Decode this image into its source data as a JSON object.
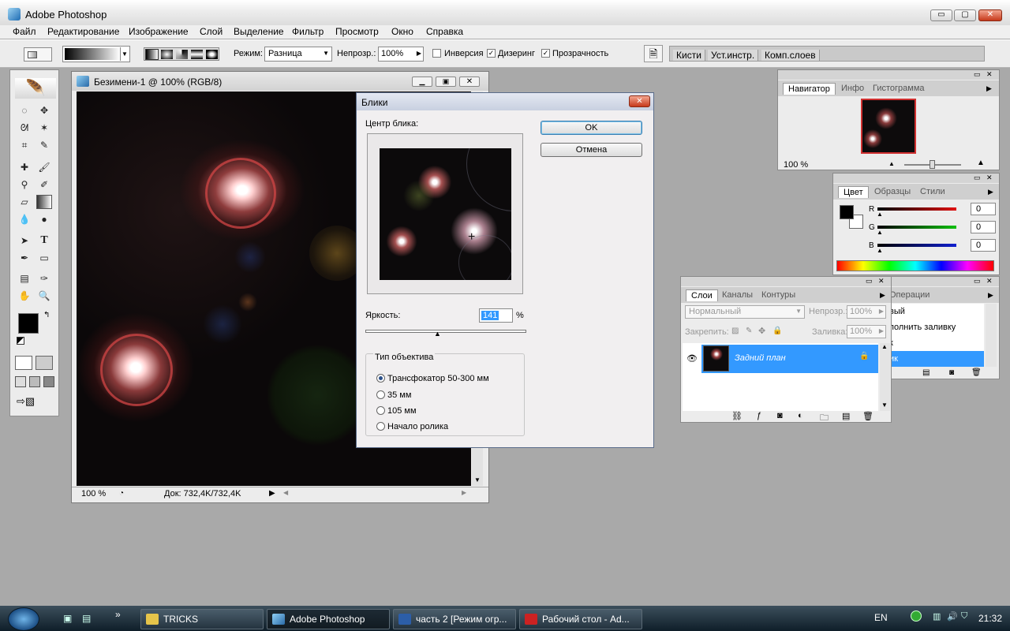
{
  "window": {
    "title": "Adobe Photoshop",
    "min": "▭",
    "max": "▢",
    "close": "✕"
  },
  "menu": [
    "Файл",
    "Редактирование",
    "Изображение",
    "Слой",
    "Выделение",
    "Фильтр",
    "Просмотр",
    "Окно",
    "Справка"
  ],
  "options": {
    "mode_label": "Режим:",
    "mode_value": "Разница",
    "opacity_label": "Непрозр.:",
    "opacity_value": "100%",
    "inversion": "Инверсия",
    "dither": "Дизеринг",
    "transparency": "Прозрачность",
    "inversion_checked": false,
    "dither_checked": true,
    "transparency_checked": true
  },
  "palette_well": [
    "Кисти",
    "Уст.инстр.",
    "Комп.слоев"
  ],
  "document": {
    "title": "Безимени-1 @ 100% (RGB/8)",
    "zoom": "100 %",
    "doc_info": "Док: 732,4K/732,4K"
  },
  "dialog": {
    "title": "Блики",
    "center_label": "Центр блика:",
    "ok": "OK",
    "cancel": "Отмена",
    "brightness_label": "Яркость:",
    "brightness_value": "141",
    "percent": "%",
    "lens_group": "Тип объектива",
    "lens_options": [
      "Трансфокатор 50-300 мм",
      "35 мм",
      "105 мм",
      "Начало ролика"
    ],
    "lens_selected": 0
  },
  "navigator": {
    "tabs": [
      "Навигатор",
      "Инфо",
      "Гистограмма"
    ],
    "zoom": "100 %"
  },
  "color_panel": {
    "tabs": [
      "Цвет",
      "Образцы",
      "Стили"
    ],
    "channels": [
      {
        "name": "R",
        "value": "0",
        "color": "#e01010"
      },
      {
        "name": "G",
        "value": "0",
        "color": "#10c010"
      },
      {
        "name": "B",
        "value": "0",
        "color": "#1020d0"
      }
    ]
  },
  "layers": {
    "tabs": [
      "Слои",
      "Каналы",
      "Контуры"
    ],
    "blend": "Нормальный",
    "opacity_label": "Непрозр.:",
    "opacity_value": "100%",
    "lock_label": "Закрепить:",
    "fill_label": "Заливка:",
    "fill_value": "100%",
    "layer_name": "Задний план"
  },
  "history": {
    "tab": "Операции",
    "items": [
      "вый",
      "полнить заливку",
      "к",
      "ик"
    ]
  },
  "taskbar": {
    "tasks": [
      "TRICKS",
      "Adobe Photoshop",
      "часть 2 [Режим огр...",
      "Рабочий стол - Ad..."
    ],
    "lang": "EN",
    "clock": "21:32",
    "chevron": "»"
  }
}
